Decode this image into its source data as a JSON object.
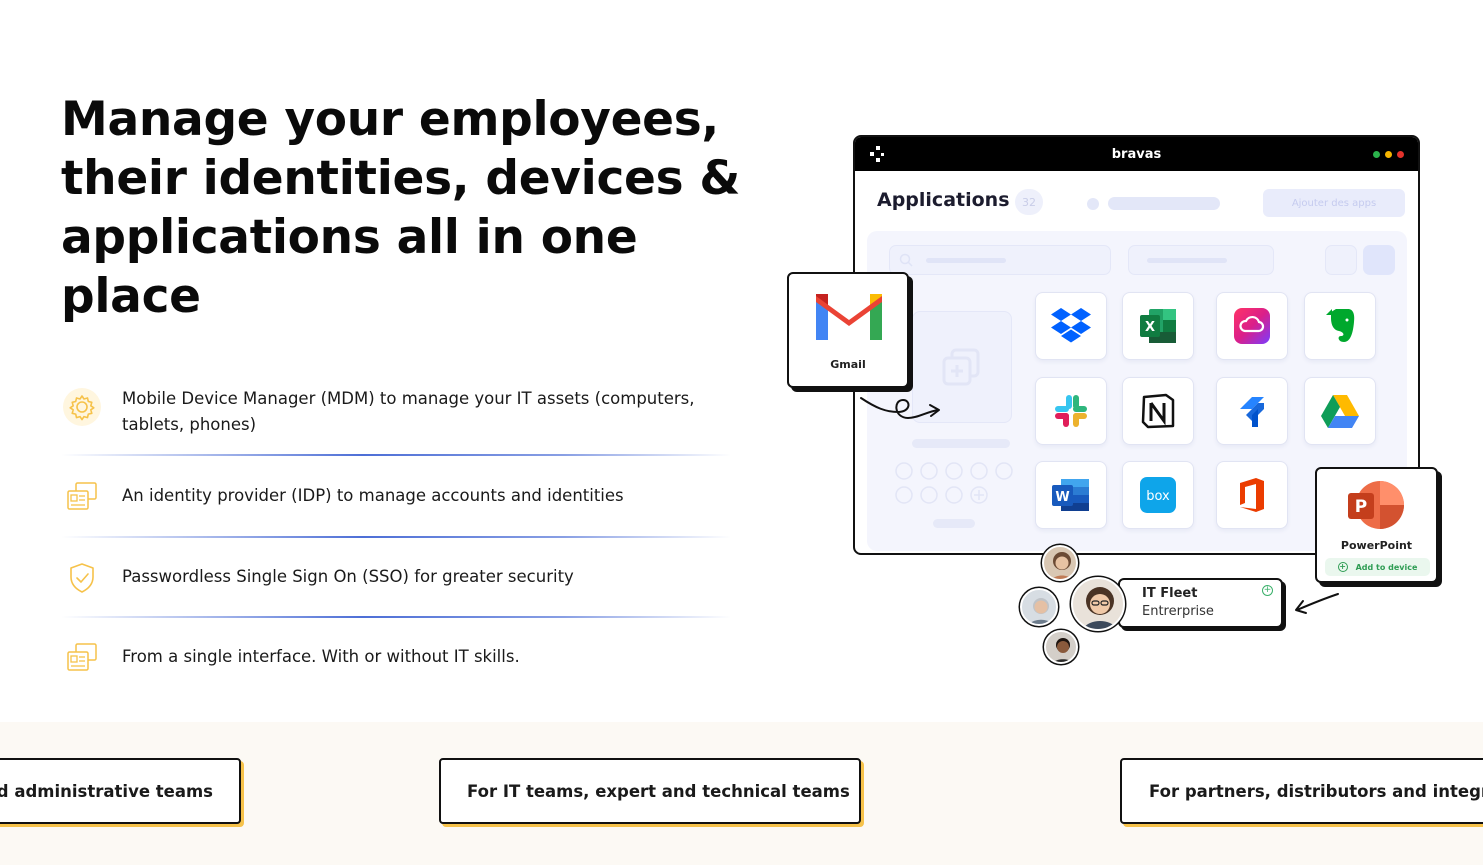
{
  "hero": {
    "title": "Manage your employees, their identities, devices & applications all in one place"
  },
  "features": [
    {
      "icon": "gear-icon",
      "text": "Mobile Device Manager (MDM) to manage your IT assets (computers, tablets, phones)"
    },
    {
      "icon": "identity-cards-icon",
      "text": "An identity provider (IDP) to manage accounts and identities"
    },
    {
      "icon": "shield-check-icon",
      "text": "Passwordless Single Sign On (SSO) for greater security"
    },
    {
      "icon": "identity-cards-icon",
      "text": "From a single interface. With or without IT skills."
    }
  ],
  "illustration": {
    "window_title": "bravas",
    "section_title": "Applications",
    "app_count": "32",
    "add_button": "Ajouter des apps",
    "apps": [
      "Dropbox",
      "Excel",
      "Creative Cloud",
      "Evernote",
      "Slack",
      "Notion",
      "Jira",
      "Google Drive",
      "Word",
      "Box",
      "Office"
    ],
    "gmail_label": "Gmail",
    "powerpoint_label": "PowerPoint",
    "add_to_device": "Add to device",
    "fleet_title": "IT Fleet",
    "fleet_plan": "Entrerprise",
    "colors": {
      "accent_yellow": "#f6c24a",
      "divider_blue": "#3a5fd2",
      "dot_green": "#2bb24c",
      "dot_yellow": "#f5b400",
      "dot_red": "#e3322b"
    }
  },
  "audience_tabs": [
    {
      "label": "nd administrative teams"
    },
    {
      "label": "For IT teams, expert and technical teams"
    },
    {
      "label": "For partners, distributors and integra"
    }
  ]
}
